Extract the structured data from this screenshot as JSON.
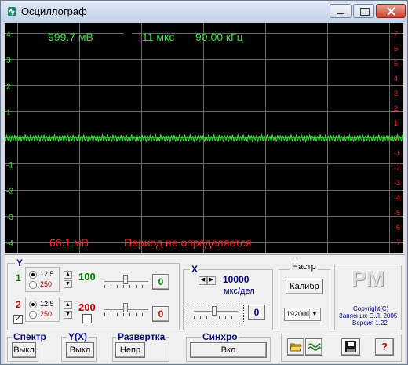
{
  "window": {
    "title": "Осциллограф"
  },
  "readout": {
    "voltage": "999.7 мВ",
    "time": "11 мкс",
    "frequency": "90.00 кГц",
    "min_voltage": "66.1 мВ",
    "period_message": "Период не определяется"
  },
  "axes": {
    "left_ticks": [
      "4",
      "3",
      "2",
      "1",
      "-1",
      "-2",
      "-3",
      "-4"
    ],
    "right_ticks": [
      "7",
      "6",
      "5",
      "4",
      "3",
      "2",
      "1",
      "0",
      "-1",
      "-2",
      "-3",
      "-4",
      "-5",
      "-6",
      "-7"
    ]
  },
  "signal": {
    "amplitude_fraction": 0.12,
    "cycles": 150
  },
  "y_group": {
    "label": "Y",
    "ch1": {
      "label": "1",
      "opt_a": "12,5",
      "opt_b": "250",
      "gain": "100",
      "value_button": "0",
      "color": "#008000"
    },
    "ch2": {
      "label": "2",
      "opt_a": "12,5",
      "opt_b": "250",
      "gain": "200",
      "value_button": "0",
      "color": "#c00000",
      "enabled": "✓"
    }
  },
  "x_group": {
    "label": "X",
    "timebase": "10000",
    "unit": "мкс/дел",
    "value_button": "0"
  },
  "nastr_group": {
    "label": "Настр",
    "calibrate_button": "Калибр",
    "sample_rate": "192000"
  },
  "logo": {
    "text": "PM",
    "copyright": "Copyright(C)",
    "author": "Запясных О.Л. 2005",
    "version": "Версия 1.22"
  },
  "spectr": {
    "label": "Спектр",
    "button": "Выкл"
  },
  "yx": {
    "label": "Y(X)",
    "button": "Выкл"
  },
  "razvertka": {
    "label": "Развертка",
    "button": "Непр"
  },
  "sinhro": {
    "label": "Синхро",
    "button": "Вкл"
  },
  "tool_icons": [
    "open-folder-icon",
    "wave-icon",
    "save-icon",
    "help-icon"
  ],
  "help_label": "?"
}
